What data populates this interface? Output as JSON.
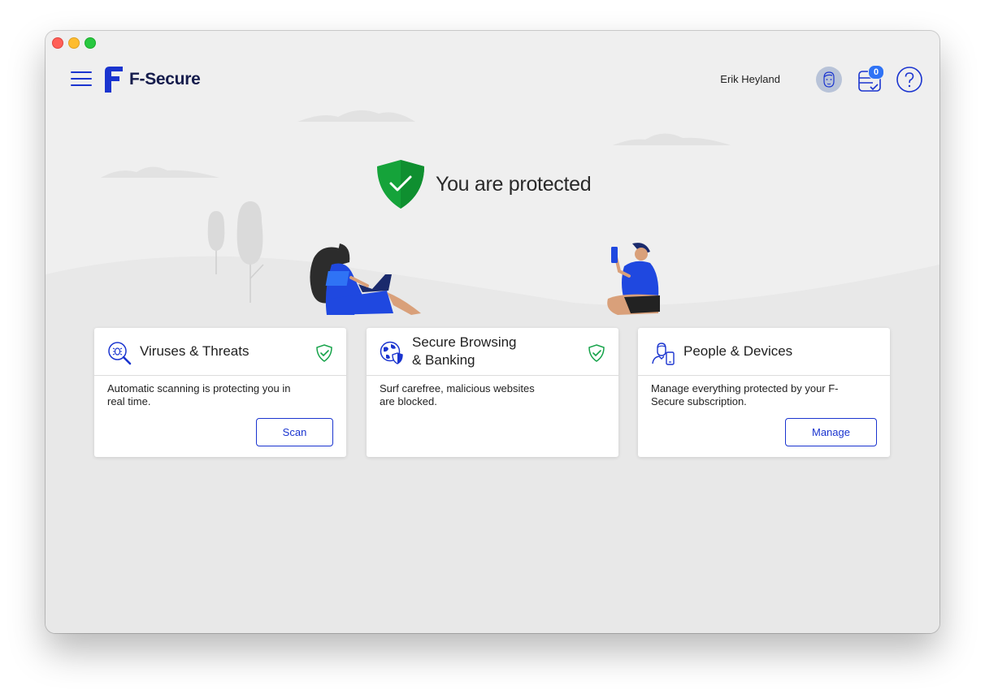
{
  "app": {
    "brand": "F-Secure",
    "accent_color": "#1a34cf",
    "ok_color": "#16a34a"
  },
  "header": {
    "menu_icon": "hamburger-icon",
    "user_name": "Erik Heyland",
    "avatar_icon": "user-face-icon",
    "subscription_icon": "subscription-icon",
    "notification_count": "0",
    "help_icon": "question-icon"
  },
  "status": {
    "title": "You are protected",
    "icon": "shield-check-icon"
  },
  "cards": [
    {
      "title": "Viruses & Threats",
      "icon": "bug-search-icon",
      "description": "Automatic scanning is protecting you in\nreal time.",
      "button": "Scan",
      "protected": true
    },
    {
      "title": "Secure Browsing\n& Banking",
      "icon": "globe-shield-icon",
      "description": "Surf carefree, malicious websites\nare blocked.",
      "protected": true
    },
    {
      "title": "People & Devices",
      "icon": "person-device-icon",
      "description": "Manage everything protected by your F-\nSecure subscription.",
      "button": "Manage",
      "protected": false
    }
  ]
}
